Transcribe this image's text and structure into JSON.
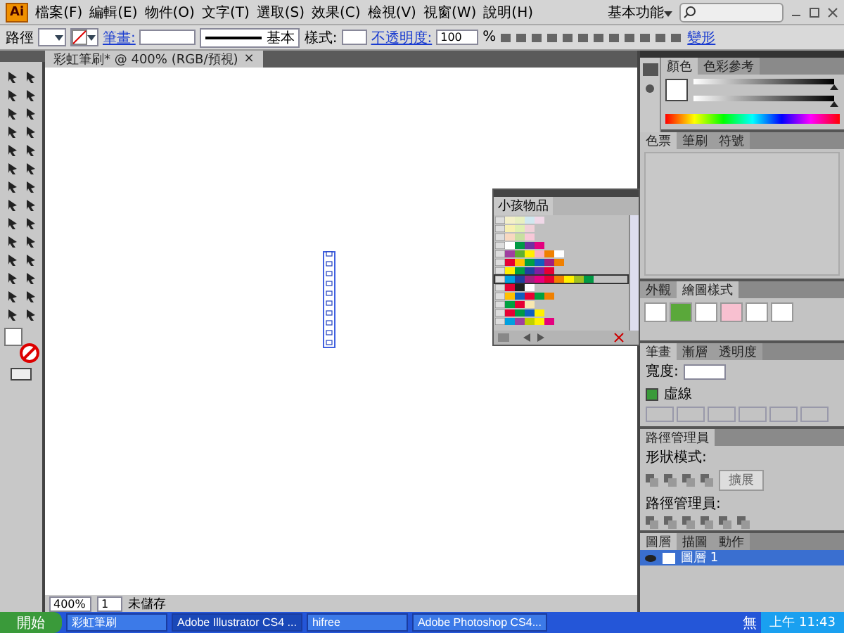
{
  "app_logo": "Ai",
  "menu_bar": {
    "items": [
      "檔案(F)",
      "編輯(E)",
      "物件(O)",
      "文字(T)",
      "選取(S)",
      "效果(C)",
      "檢視(V)",
      "視窗(W)",
      "說明(H)"
    ],
    "workspace": "基本功能"
  },
  "control_bar": {
    "selection": "路徑",
    "stroke_label": "筆畫:",
    "brush": "基本",
    "style_label": "樣式:",
    "opacity_label": "不透明度:",
    "opacity": "100",
    "percent": "%",
    "transform": "變形"
  },
  "document_tab": {
    "title": "彩虹筆刷* @ 400% (RGB/預視)",
    "close": "×"
  },
  "swatch_library": {
    "title": "小孩物品",
    "rows": [
      {
        "selected": false,
        "colors": [
          {
            "color": "#f4f0c8"
          },
          {
            "color": "#e8f0c0"
          },
          {
            "color": "#d0e8f0"
          },
          {
            "color": "#f0d8e8"
          }
        ]
      },
      {
        "selected": false,
        "colors": [
          {
            "color": "#f8f0b0"
          },
          {
            "color": "#e0f0b0"
          },
          {
            "color": "#f0d0d8"
          }
        ]
      },
      {
        "selected": false,
        "colors": [
          {
            "color": "#f8d8c0"
          },
          {
            "color": "#c8e0a0"
          },
          {
            "color": "#f8c8d8"
          }
        ]
      },
      {
        "selected": false,
        "colors": [
          {
            "color": "#ffffff"
          },
          {
            "color": "#009944"
          },
          {
            "color": "#7030a0"
          },
          {
            "color": "#e4007f"
          }
        ]
      },
      {
        "selected": false,
        "colors": [
          {
            "color": "#a040a0"
          },
          {
            "color": "#60b030"
          },
          {
            "color": "#fff000"
          },
          {
            "color": "#f8b0c0"
          },
          {
            "color": "#f08000"
          },
          {
            "color": "#ffffff"
          }
        ]
      },
      {
        "selected": false,
        "colors": [
          {
            "color": "#e60033"
          },
          {
            "color": "#ffc000"
          },
          {
            "color": "#00a040"
          },
          {
            "color": "#1060c0"
          },
          {
            "color": "#a02080"
          },
          {
            "color": "#f08000"
          }
        ]
      },
      {
        "selected": false,
        "colors": [
          {
            "color": "#fff000"
          },
          {
            "color": "#00a040"
          },
          {
            "color": "#2040a0"
          },
          {
            "color": "#8020a0"
          },
          {
            "color": "#e60033"
          }
        ]
      },
      {
        "selected": true,
        "colors": [
          {
            "color": "#00a0e0"
          },
          {
            "color": "#2040a0"
          },
          {
            "color": "#a02080"
          },
          {
            "color": "#e4007f"
          },
          {
            "color": "#e60033"
          },
          {
            "color": "#f08000"
          },
          {
            "color": "#fff000"
          },
          {
            "color": "#a0c020"
          },
          {
            "color": "#009944"
          }
        ]
      },
      {
        "selected": false,
        "colors": [
          {
            "color": "#e60033"
          },
          {
            "color": "#222222"
          },
          {
            "color": "#ffffff"
          }
        ]
      },
      {
        "selected": false,
        "colors": [
          {
            "color": "#ffc000"
          },
          {
            "color": "#1060c0"
          },
          {
            "color": "#e60033"
          },
          {
            "color": "#00a040"
          },
          {
            "color": "#f08000"
          }
        ]
      },
      {
        "selected": false,
        "colors": [
          {
            "color": "#00a040"
          },
          {
            "color": "#e60033"
          },
          {
            "color": "#f8e8b0"
          }
        ]
      },
      {
        "selected": false,
        "colors": [
          {
            "color": "#e60033"
          },
          {
            "color": "#009944"
          },
          {
            "color": "#1060c0"
          },
          {
            "color": "#fff000"
          }
        ]
      },
      {
        "selected": false,
        "colors": [
          {
            "color": "#00a0e0"
          },
          {
            "color": "#a040a0"
          },
          {
            "color": "#c0d000"
          },
          {
            "color": "#fff000"
          },
          {
            "color": "#e4007f"
          }
        ]
      }
    ]
  },
  "color_panel": {
    "sliders": [
      {
        "level": 1
      },
      {
        "level": 1
      }
    ],
    "tabs": [
      {
        "label": "顏色",
        "selected": true
      },
      {
        "label": "色彩參考",
        "selected": false
      }
    ]
  },
  "swatches_panel": {
    "tabs": [
      {
        "label": "色票",
        "selected": true
      },
      {
        "label": "筆刷",
        "selected": false
      },
      {
        "label": "符號",
        "selected": false
      }
    ]
  },
  "styles_panel": {
    "tabs": [
      {
        "label": "外觀",
        "selected": false
      },
      {
        "label": "繪圖樣式",
        "selected": true
      }
    ]
  },
  "stroke_panel": {
    "tabs": [
      {
        "label": "筆畫",
        "selected": true
      },
      {
        "label": "漸層",
        "selected": false
      },
      {
        "label": "透明度",
        "selected": false
      }
    ],
    "width_label": "寬度:",
    "dashed_label": "虛線",
    "dashed": true
  },
  "pathfinder_panel": {
    "title": "路徑管理員",
    "shape_modes_label": "形狀模式:",
    "expand_button": "擴展",
    "pathfinders_label": "路徑管理員:"
  },
  "layers_panel": {
    "tabs": [
      {
        "label": "圖層",
        "selected": true
      },
      {
        "label": "描圖",
        "selected": false
      },
      {
        "label": "動作",
        "selected": false
      }
    ],
    "layers": [
      {
        "name": "圖層 1",
        "selected": true,
        "visible": true
      }
    ]
  },
  "status_bar": {
    "zoom": "400%",
    "page": "1",
    "status": "未儲存"
  },
  "taskbar": {
    "start": "開始",
    "tasks": [
      {
        "label": "彩虹筆刷",
        "selected": false
      },
      {
        "label": "Adobe Illustrator CS4 ...",
        "selected": true
      },
      {
        "label": "hifree",
        "selected": false
      },
      {
        "label": "Adobe Photoshop CS4...",
        "selected": false
      }
    ],
    "ime": "無",
    "clock": "上午 11:43"
  }
}
